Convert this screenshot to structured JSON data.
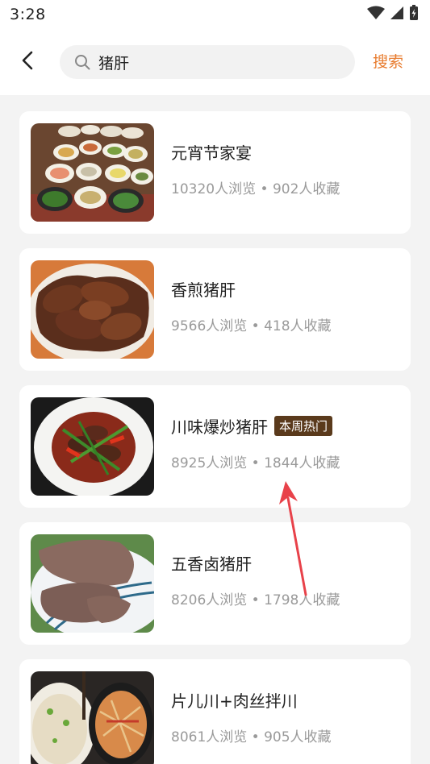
{
  "status_bar": {
    "time": "3:28"
  },
  "header": {
    "search_value": "猪肝",
    "submit_label": "搜索"
  },
  "results": [
    {
      "title": "元宵节家宴",
      "views": "10320人浏览",
      "separator": "•",
      "favorites": "902人收藏",
      "badge": ""
    },
    {
      "title": "香煎猪肝",
      "views": "9566人浏览",
      "separator": "•",
      "favorites": "418人收藏",
      "badge": ""
    },
    {
      "title": "川味爆炒猪肝",
      "views": "8925人浏览",
      "separator": "•",
      "favorites": "1844人收藏",
      "badge": "本周热门"
    },
    {
      "title": "五香卤猪肝",
      "views": "8206人浏览",
      "separator": "•",
      "favorites": "1798人收藏",
      "badge": ""
    },
    {
      "title": "片儿川+肉丝拌川",
      "views": "8061人浏览",
      "separator": "•",
      "favorites": "905人收藏",
      "badge": ""
    }
  ],
  "colors": {
    "accent": "#e87c2f",
    "badge_bg": "#5a3a1c",
    "annotation_arrow": "#e8424a"
  }
}
